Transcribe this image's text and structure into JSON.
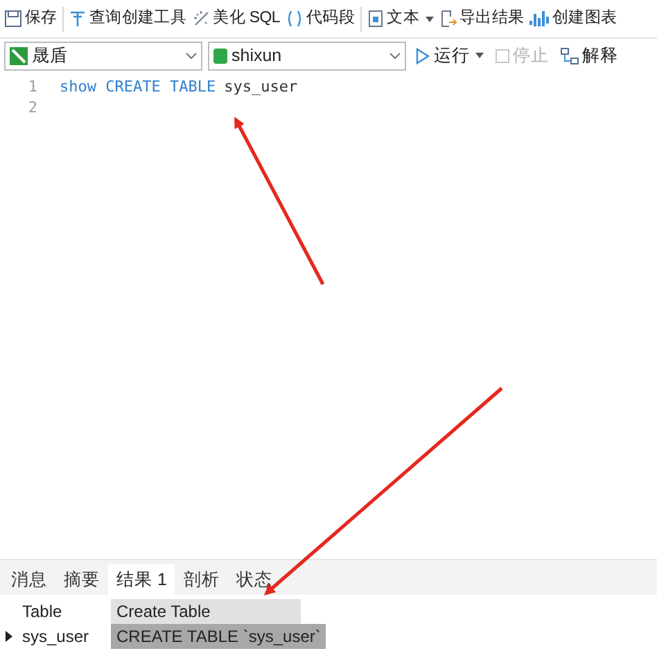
{
  "toolbar": [
    {
      "kind": "save",
      "label": "保存"
    },
    {
      "kind": "query-builder",
      "label": "查询创建工具"
    },
    {
      "kind": "beautify",
      "label": "美化 SQL"
    },
    {
      "kind": "snippet",
      "label": "代码段"
    },
    {
      "kind": "text",
      "label": "文本",
      "dropdown": true
    },
    {
      "kind": "export",
      "label": "导出结果"
    },
    {
      "kind": "chart",
      "label": "创建图表"
    }
  ],
  "connection": {
    "value": "晟盾"
  },
  "database": {
    "value": "shixun"
  },
  "actions": [
    {
      "kind": "run",
      "label": "运行",
      "dropdown": true,
      "disabled": false
    },
    {
      "kind": "stop",
      "label": "停止",
      "disabled": true
    },
    {
      "kind": "explain",
      "label": "解释",
      "disabled": false
    }
  ],
  "editor": {
    "lines": [
      {
        "number": "1",
        "tokens": [
          {
            "kind": "keyword",
            "text": "show CREATE TABLE"
          },
          {
            "kind": "plain",
            "text": "sys_user"
          }
        ]
      },
      {
        "number": "2"
      }
    ]
  },
  "result_tabs": [
    {
      "label": "消息",
      "selected": false
    },
    {
      "label": "摘要",
      "selected": false
    },
    {
      "label": "结果 1",
      "selected": true
    },
    {
      "label": "剖析",
      "selected": false
    },
    {
      "label": "状态",
      "selected": false
    }
  ],
  "table": {
    "columns": [
      "Table",
      "Create Table"
    ],
    "rows": [
      {
        "selected": true,
        "cells": [
          "sys_user",
          "CREATE TABLE `sys_user`"
        ]
      }
    ]
  }
}
